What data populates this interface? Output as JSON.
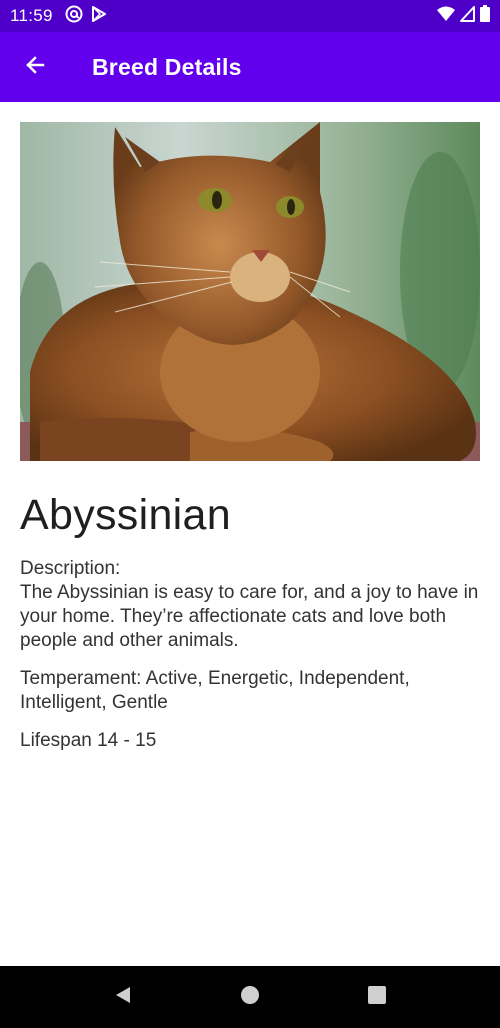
{
  "status_bar": {
    "time": "11:59",
    "icons_left": [
      "at-sign-icon",
      "play-store-icon"
    ],
    "icons_right": [
      "wifi-icon",
      "signal-icon",
      "battery-icon"
    ]
  },
  "app_bar": {
    "title": "Breed Details",
    "back_icon": "arrow-back-icon",
    "color": "#6200ee"
  },
  "breed": {
    "name": "Abyssinian",
    "description_label": "Description:",
    "description": "The Abyssinian is easy to care for, and a joy to have in your home. They’re affectionate cats and love both people and other animals.",
    "temperament": "Temperament: Active, Energetic, Independent, Intelligent, Gentle",
    "lifespan": "Lifespan 14 - 15"
  },
  "nav_bar": {
    "back_icon": "nav-back-icon",
    "home_icon": "nav-home-icon",
    "recents_icon": "nav-recents-icon"
  }
}
